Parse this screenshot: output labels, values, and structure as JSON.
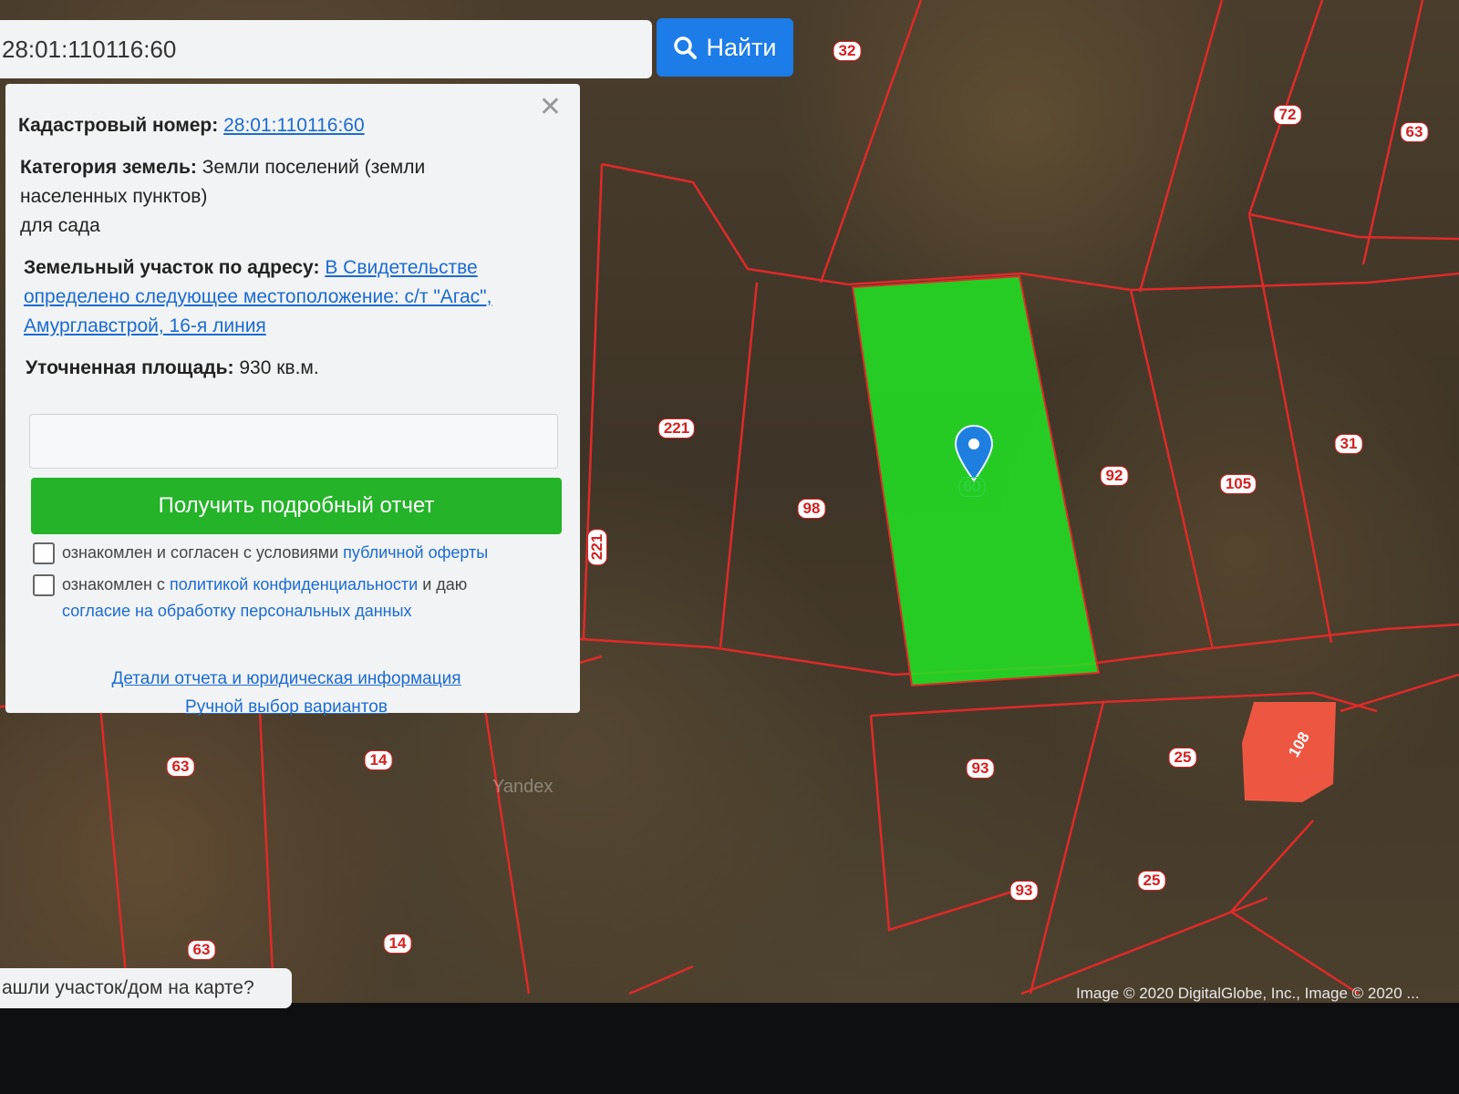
{
  "search": {
    "value": "28:01:110116:60",
    "button_label": "Найти"
  },
  "panel": {
    "cadastral_label": "Кадастровый номер:",
    "cadastral_value": "28:01:110116:60",
    "category_label": "Категория земель:",
    "category_value": "Земли поселений (земли",
    "category_value_2": "населенных пунктов)",
    "category_value_3": "для сада",
    "address_label": "Земельный участок по адресу:",
    "address_value_1": "В Свидетельстве",
    "address_value_2": "определено следующее местоположение: с/т \"Агас\",",
    "address_value_3": "Амурглавстрой, 16-я линия",
    "area_label": "Уточненная площадь:",
    "area_value": "930 кв.м.",
    "email_placeholder": "",
    "report_button": "Получить подробный отчет",
    "check1_text": "ознакомлен и согласен с условиями",
    "check1_link": "публичной оферты",
    "check2_text_a": "ознакомлен с",
    "check2_link": "политикой конфиденциальности",
    "check2_text_b": "и даю",
    "check2_link_2": "согласие на обработку персональных данных",
    "link_details": "Детали отчета и юридическая информация",
    "link_manual": "Ручной выбор вариантов"
  },
  "map": {
    "found_prompt": "ашли участок/дом на карте?",
    "copyright": "Image © 2020 DigitalGlobe, Inc., Image © 2020 ...",
    "watermark": "Yandex",
    "selected_lot": "60",
    "lot_labels": [
      "32",
      "72",
      "63",
      "221",
      "98",
      "92",
      "105",
      "31",
      "221",
      "63",
      "14",
      "93",
      "25",
      "108",
      "25",
      "93",
      "63",
      "14"
    ],
    "colors": {
      "boundary": "#e02a2a",
      "selected": "#26e026",
      "pin": "#1e7fe0"
    }
  }
}
